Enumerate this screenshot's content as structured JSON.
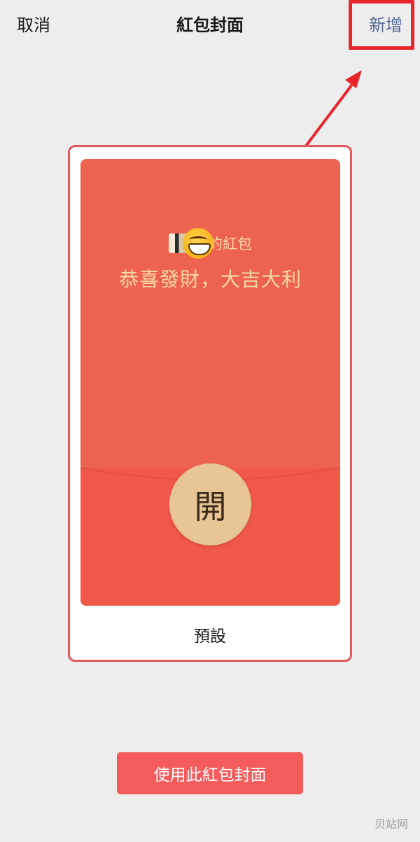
{
  "header": {
    "cancel_label": "取消",
    "title": "紅包封面",
    "add_label": "新增"
  },
  "envelope": {
    "sender_suffix": "的紅包",
    "greeting": "恭喜發財，大吉大利",
    "open_label": "開",
    "caption": "預設"
  },
  "footer": {
    "use_button_label": "使用此紅包封面"
  },
  "watermark": "贝站网",
  "colors": {
    "envelope_red": "#ee6250",
    "accent_link": "#576b95",
    "highlight": "#e7252a",
    "button_red": "#f45b5b",
    "gold": "#e7c594"
  }
}
